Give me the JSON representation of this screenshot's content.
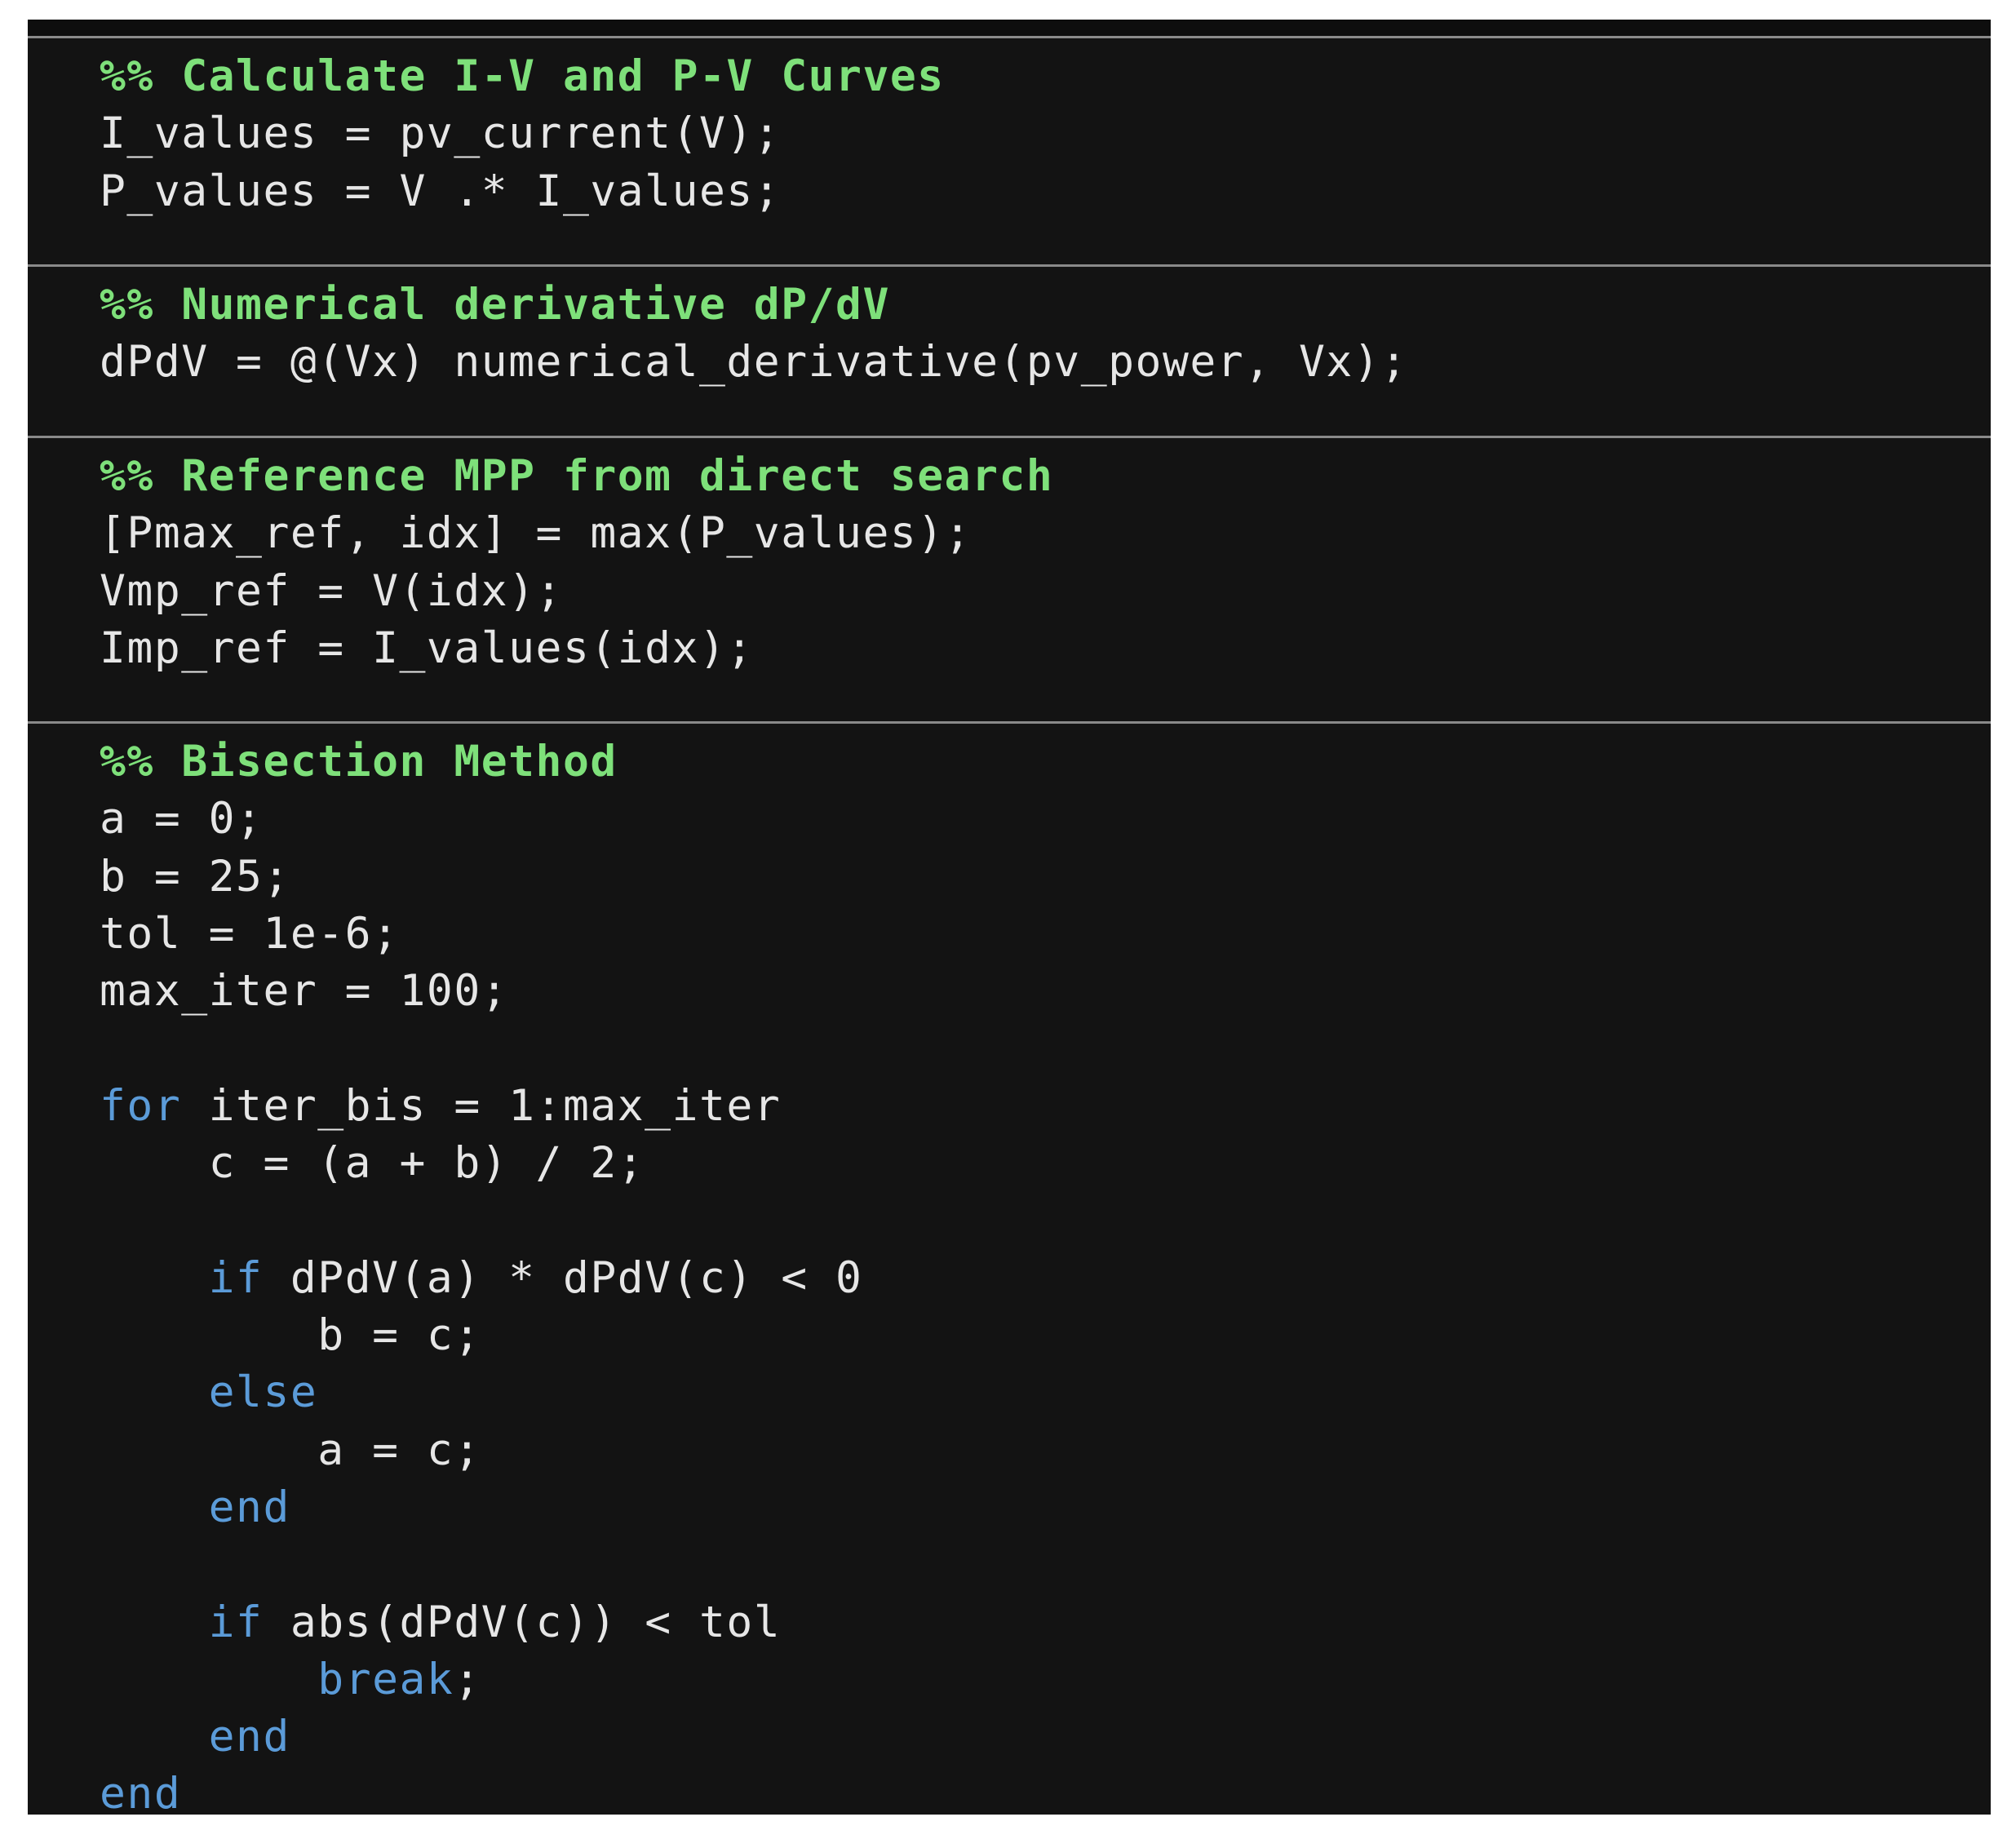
{
  "sections": [
    {
      "lines": [
        {
          "parts": [
            {
              "t": "%% Calculate I-V and P-V Curves",
              "c": "comment"
            }
          ]
        },
        {
          "parts": [
            {
              "t": "I_values = pv_current(V);",
              "c": "plain"
            }
          ]
        },
        {
          "parts": [
            {
              "t": "P_values = V .* I_values;",
              "c": "plain"
            }
          ]
        }
      ]
    },
    {
      "lines": [
        {
          "parts": [
            {
              "t": "%% Numerical derivative dP/dV",
              "c": "comment"
            }
          ]
        },
        {
          "parts": [
            {
              "t": "dPdV = @(Vx) numerical_derivative(pv_power, Vx);",
              "c": "plain"
            }
          ]
        }
      ]
    },
    {
      "lines": [
        {
          "parts": [
            {
              "t": "%% Reference MPP from direct search",
              "c": "comment"
            }
          ]
        },
        {
          "parts": [
            {
              "t": "[Pmax_ref, idx] = max(P_values);",
              "c": "plain"
            }
          ]
        },
        {
          "parts": [
            {
              "t": "Vmp_ref = V(idx);",
              "c": "plain"
            }
          ]
        },
        {
          "parts": [
            {
              "t": "Imp_ref = I_values(idx);",
              "c": "plain"
            }
          ]
        }
      ]
    },
    {
      "lines": [
        {
          "parts": [
            {
              "t": "%% Bisection Method",
              "c": "comment"
            }
          ]
        },
        {
          "parts": [
            {
              "t": "a = 0;",
              "c": "plain"
            }
          ]
        },
        {
          "parts": [
            {
              "t": "b = 25;",
              "c": "plain"
            }
          ]
        },
        {
          "parts": [
            {
              "t": "tol = 1e-6;",
              "c": "plain"
            }
          ]
        },
        {
          "parts": [
            {
              "t": "max_iter = 100;",
              "c": "plain"
            }
          ]
        },
        {
          "parts": []
        },
        {
          "parts": [
            {
              "t": "for",
              "c": "kw"
            },
            {
              "t": " iter_bis = 1:max_iter",
              "c": "plain"
            }
          ]
        },
        {
          "parts": [
            {
              "t": "    c = (a + b) / 2;",
              "c": "plain"
            }
          ]
        },
        {
          "parts": []
        },
        {
          "parts": [
            {
              "t": "    ",
              "c": "plain"
            },
            {
              "t": "if",
              "c": "kw"
            },
            {
              "t": " dPdV(a) * dPdV(c) < 0",
              "c": "plain"
            }
          ]
        },
        {
          "parts": [
            {
              "t": "        b = c;",
              "c": "plain"
            }
          ]
        },
        {
          "parts": [
            {
              "t": "    ",
              "c": "plain"
            },
            {
              "t": "else",
              "c": "kw"
            }
          ]
        },
        {
          "parts": [
            {
              "t": "        a = c;",
              "c": "plain"
            }
          ]
        },
        {
          "parts": [
            {
              "t": "    ",
              "c": "plain"
            },
            {
              "t": "end",
              "c": "kw"
            }
          ]
        },
        {
          "parts": []
        },
        {
          "parts": [
            {
              "t": "    ",
              "c": "plain"
            },
            {
              "t": "if",
              "c": "kw"
            },
            {
              "t": " abs(dPdV(c)) < tol",
              "c": "plain"
            }
          ]
        },
        {
          "parts": [
            {
              "t": "        ",
              "c": "plain"
            },
            {
              "t": "break",
              "c": "kw"
            },
            {
              "t": ";",
              "c": "plain"
            }
          ]
        },
        {
          "parts": [
            {
              "t": "    ",
              "c": "plain"
            },
            {
              "t": "end",
              "c": "kw"
            }
          ]
        },
        {
          "parts": [
            {
              "t": "end",
              "c": "kw"
            }
          ]
        }
      ]
    }
  ],
  "colors": {
    "background": "#131313",
    "comment": "#7ee07a",
    "keyword": "#5b9bd8",
    "text": "#e6e6e6",
    "divider": "#8a8a8a"
  }
}
